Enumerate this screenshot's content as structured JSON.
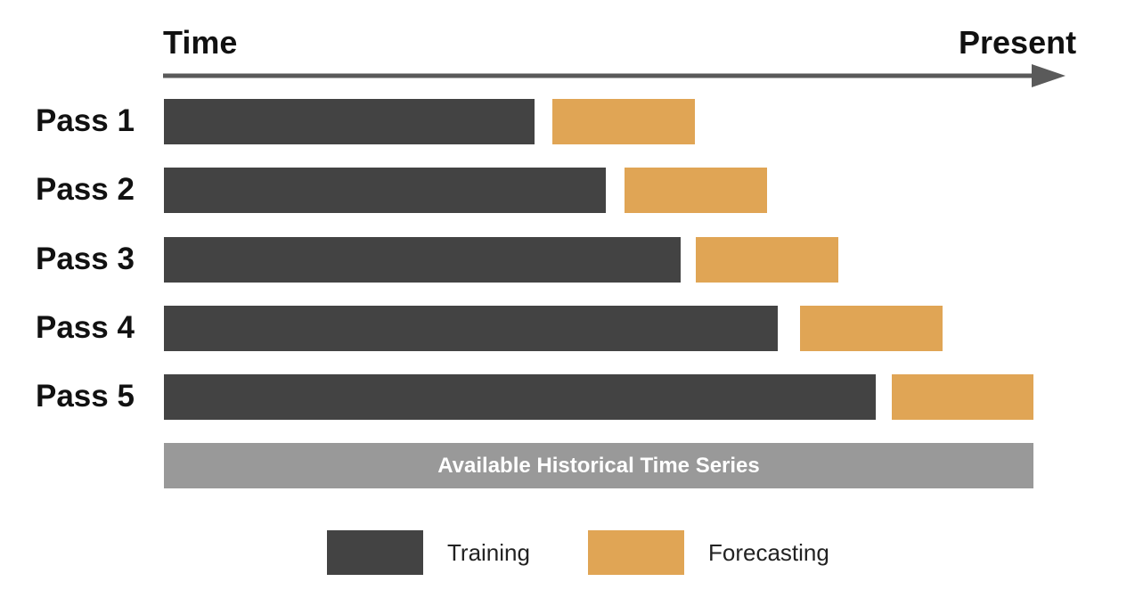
{
  "header": {
    "start_label": "Time",
    "end_label": "Present"
  },
  "passes": [
    {
      "label": "Pass 1"
    },
    {
      "label": "Pass 2"
    },
    {
      "label": "Pass 3"
    },
    {
      "label": "Pass 4"
    },
    {
      "label": "Pass 5"
    }
  ],
  "history_label": "Available Historical Time Series",
  "legend": {
    "training": "Training",
    "forecasting": "Forecasting"
  },
  "colors": {
    "training": "#434343",
    "forecasting": "#e0a555",
    "history": "#999999",
    "arrow": "#5a5a5a"
  }
}
